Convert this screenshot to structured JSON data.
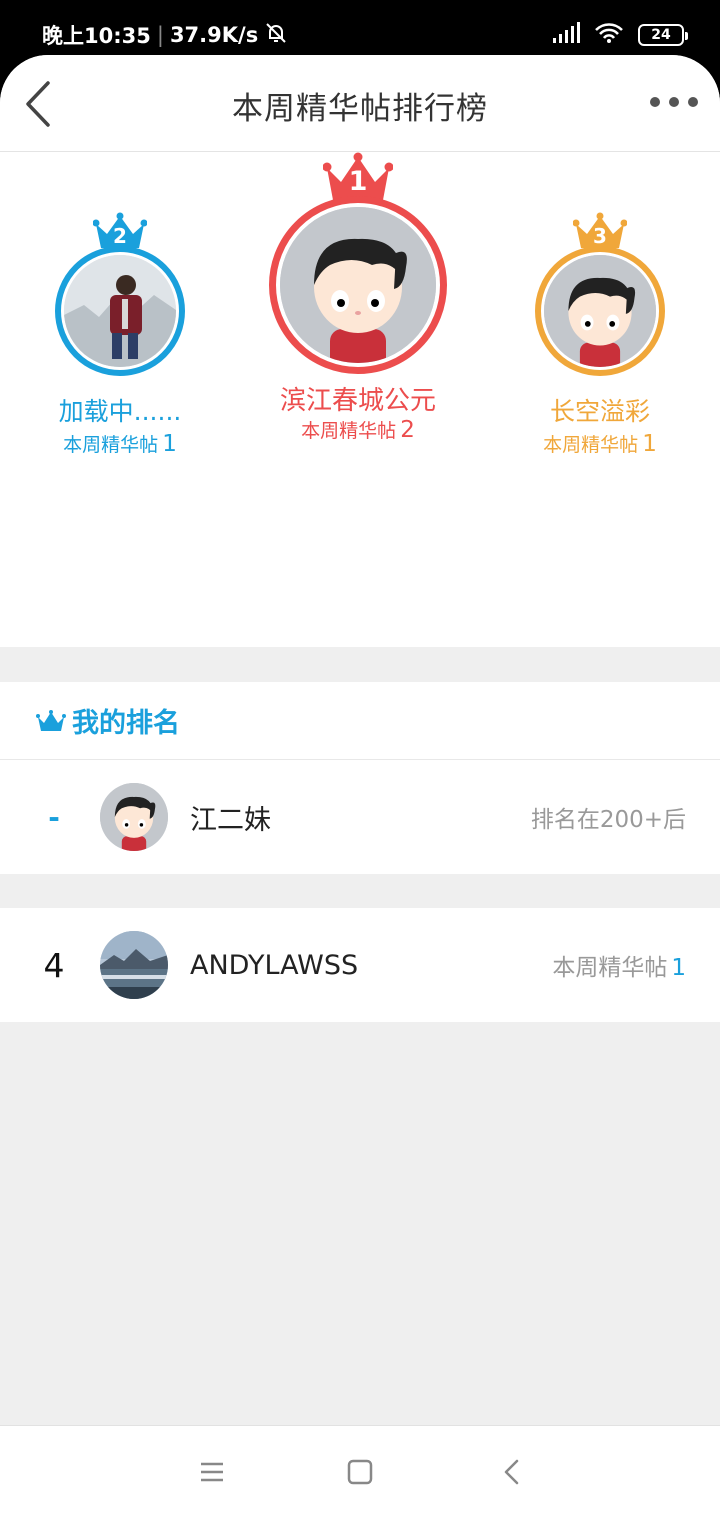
{
  "status_bar": {
    "time": "晚上10:35",
    "net_speed": "37.9K/s",
    "battery": "24",
    "icons": [
      "mute-bell-icon",
      "signal-icon",
      "wifi-icon",
      "battery-icon"
    ]
  },
  "header": {
    "title": "本周精华帖排行榜",
    "icons": [
      "back-arrow-icon",
      "more-dots-icon"
    ]
  },
  "podium": [
    {
      "rank": "1",
      "name": "滨江春城公元",
      "count_label": "本周精华帖",
      "count": "2",
      "color": "#ec4d4d"
    },
    {
      "rank": "2",
      "name": "加载中......",
      "count_label": "本周精华帖",
      "count": "1",
      "color": "#1aa0dc"
    },
    {
      "rank": "3",
      "name": "长空溢彩",
      "count_label": "本周精华帖",
      "count": "1",
      "color": "#f0a73a"
    }
  ],
  "my_ranking": {
    "title": "我的排名",
    "rank": "-",
    "name": "江二妹",
    "status": "排名在200+后"
  },
  "list": [
    {
      "rank": "4",
      "name": "ANDYLAWSS",
      "count_label": "本周精华帖",
      "count": "1"
    }
  ],
  "colors": {
    "accent_blue": "#1aa0dc",
    "gold_red": "#ec4d4d",
    "orange": "#f0a73a"
  },
  "nav_icons": [
    "menu-icon",
    "home-square-icon",
    "back-chevron-icon"
  ]
}
